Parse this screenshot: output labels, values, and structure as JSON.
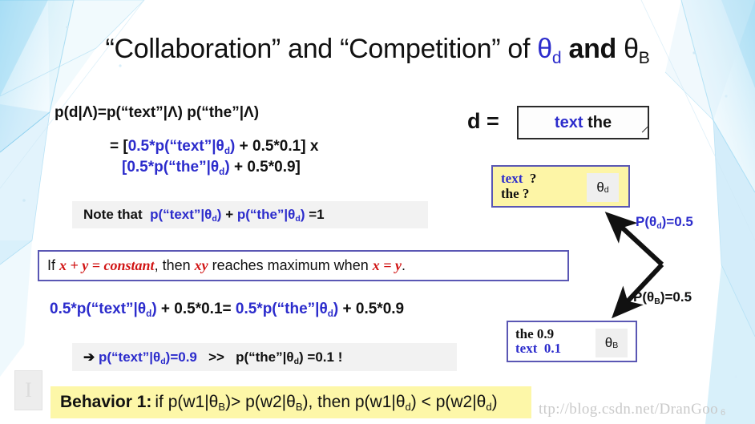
{
  "slide": {
    "title_parts": {
      "prefix": "“Collaboration” and “Competition” of ",
      "theta_d": "θ",
      "theta_d_sub": "d",
      "and": " and ",
      "theta_b": "θ",
      "theta_b_sub": "B"
    },
    "title_plain": "“Collaboration” and “Competition” of θd and θB",
    "page_number": "6",
    "watermark": "ttp://blog.csdn.net/DranGoo",
    "corner_logo_glyph": "I"
  },
  "equations": {
    "line1": "p(d|Λ)=p(“text”|Λ) p(“the”|Λ)",
    "line2_prefix": "= [",
    "line2_blue": "0.5*p(“text”|θd)",
    "line2_suffix": " + 0.5*0.1] x",
    "line3_blue": "[0.5*p(“the”|θd)",
    "line3_suffix": " + 0.5*0.9]",
    "note_prefix": "Note that",
    "note_blue_1": "p(“text”|θd)",
    "note_plus": "+",
    "note_blue_2": "p(“the”|θd)",
    "note_suffix": "=1",
    "constant_if": "If",
    "constant_xy": "x + y = constant",
    "constant_then": ", then",
    "constant_product": "xy",
    "constant_reaches": "reaches maximum when",
    "constant_equal": "x = y",
    "constant_period": ".",
    "eq4_blue_left": "0.5*p(“text”|θd)",
    "eq4_mid": " + 0.5*0.1= ",
    "eq4_blue_right": "0.5*p(“the”|θd)",
    "eq4_right_tail": " + 0.5*0.9",
    "concl_arrow": "➔",
    "concl_blue": "p(“text”|θd)=0.9",
    "concl_gg": ">>",
    "concl_black": "p(“the”|θd) =0.1 !"
  },
  "behavior": {
    "lead": "Behavior 1:",
    "rest_1": "if p(w1|θ",
    "rest_sub_1": "B",
    "rest_2": ")> p(w2|θ",
    "rest_sub_2": "B",
    "rest_3": "), then p(w1|θ",
    "rest_sub_3": "d",
    "rest_4": ") < p(w2|θ",
    "rest_sub_4": "d",
    "rest_5": ")"
  },
  "right_panel": {
    "d_label": "d =",
    "d_box_blue": "text",
    "d_box_black": "the",
    "theta_d_box": {
      "line1_blue": "text",
      "line1_q": "?",
      "line2_black": "the",
      "line2_q": "?",
      "chip": "θ",
      "chip_sub": "d"
    },
    "theta_b_box": {
      "line1_black_word": "the",
      "line1_black_value": "0.9",
      "line2_blue_word": "text",
      "line2_blue_value": "0.1",
      "chip": "θ",
      "chip_sub": "B"
    },
    "prob_theta_d": "P(θd)=0.5",
    "prob_theta_b": "P(θB)=0.5"
  },
  "colors": {
    "blue": "#2c2ccc",
    "red": "#d11414",
    "yellow_box": "#fdf5a6",
    "yellow_banner": "#fdf7a8",
    "purple_border": "#5a57b4",
    "gray_box": "#f2f2f2",
    "decor_blue": "#9fd8f5"
  }
}
